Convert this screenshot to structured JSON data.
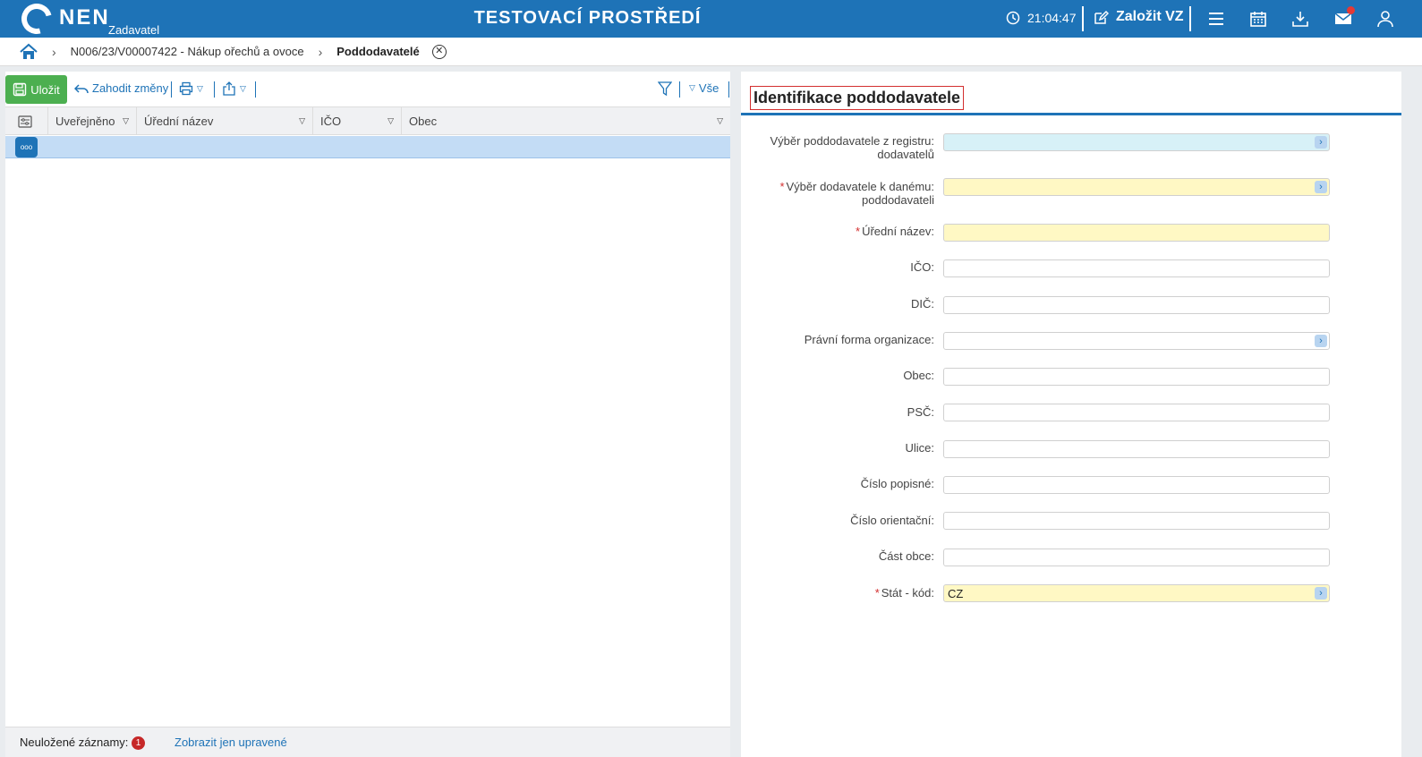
{
  "header": {
    "logo_text": "NEN",
    "logo_sub": "Zadavatel",
    "env_title": "TESTOVACÍ PROSTŘEDÍ",
    "clock": "21:04:47",
    "create_vz": "Založit VZ"
  },
  "breadcrumb": {
    "item1": "N006/23/V00007422 - Nákup ořechů a ovoce",
    "current": "Poddodavatelé"
  },
  "toolbar": {
    "save_label": "Uložit",
    "discard_label": "Zahodit změny",
    "filter_all_label": "Vše"
  },
  "grid": {
    "columns": [
      "Uveřejněno",
      "Úřední název",
      "IČO",
      "Obec"
    ],
    "row_button": "ooo"
  },
  "footer": {
    "unsaved_label": "Neuložené záznamy:",
    "unsaved_count": "1",
    "show_modified_link": "Zobrazit jen upravené"
  },
  "form": {
    "title": "Identifikace poddodavatele",
    "fields": [
      {
        "label": "Výběr poddodavatele z registru:",
        "label2": "dodavatelů",
        "required": false,
        "value": ""
      },
      {
        "label": "Výběr dodavatele k danému:",
        "label2": "poddodavateli",
        "required": true,
        "value": ""
      },
      {
        "label": "Úřední název:",
        "required": true,
        "value": ""
      },
      {
        "label": "IČO:",
        "required": false,
        "value": ""
      },
      {
        "label": "DIČ:",
        "required": false,
        "value": ""
      },
      {
        "label": "Právní forma organizace:",
        "required": false,
        "value": ""
      },
      {
        "label": "Obec:",
        "required": false,
        "value": ""
      },
      {
        "label": "PSČ:",
        "required": false,
        "value": ""
      },
      {
        "label": "Ulice:",
        "required": false,
        "value": ""
      },
      {
        "label": "Číslo popisné:",
        "required": false,
        "value": ""
      },
      {
        "label": "Číslo orientační:",
        "required": false,
        "value": ""
      },
      {
        "label": "Část obce:",
        "required": false,
        "value": ""
      },
      {
        "label": "Stát - kód:",
        "required": true,
        "value": "CZ"
      }
    ]
  },
  "colors": {
    "brand_blue": "#1e73b7",
    "save_green": "#4caf50",
    "required_red": "#d32f2f",
    "field_yellow": "#fff8c4",
    "field_blue": "#d7f1f7"
  }
}
